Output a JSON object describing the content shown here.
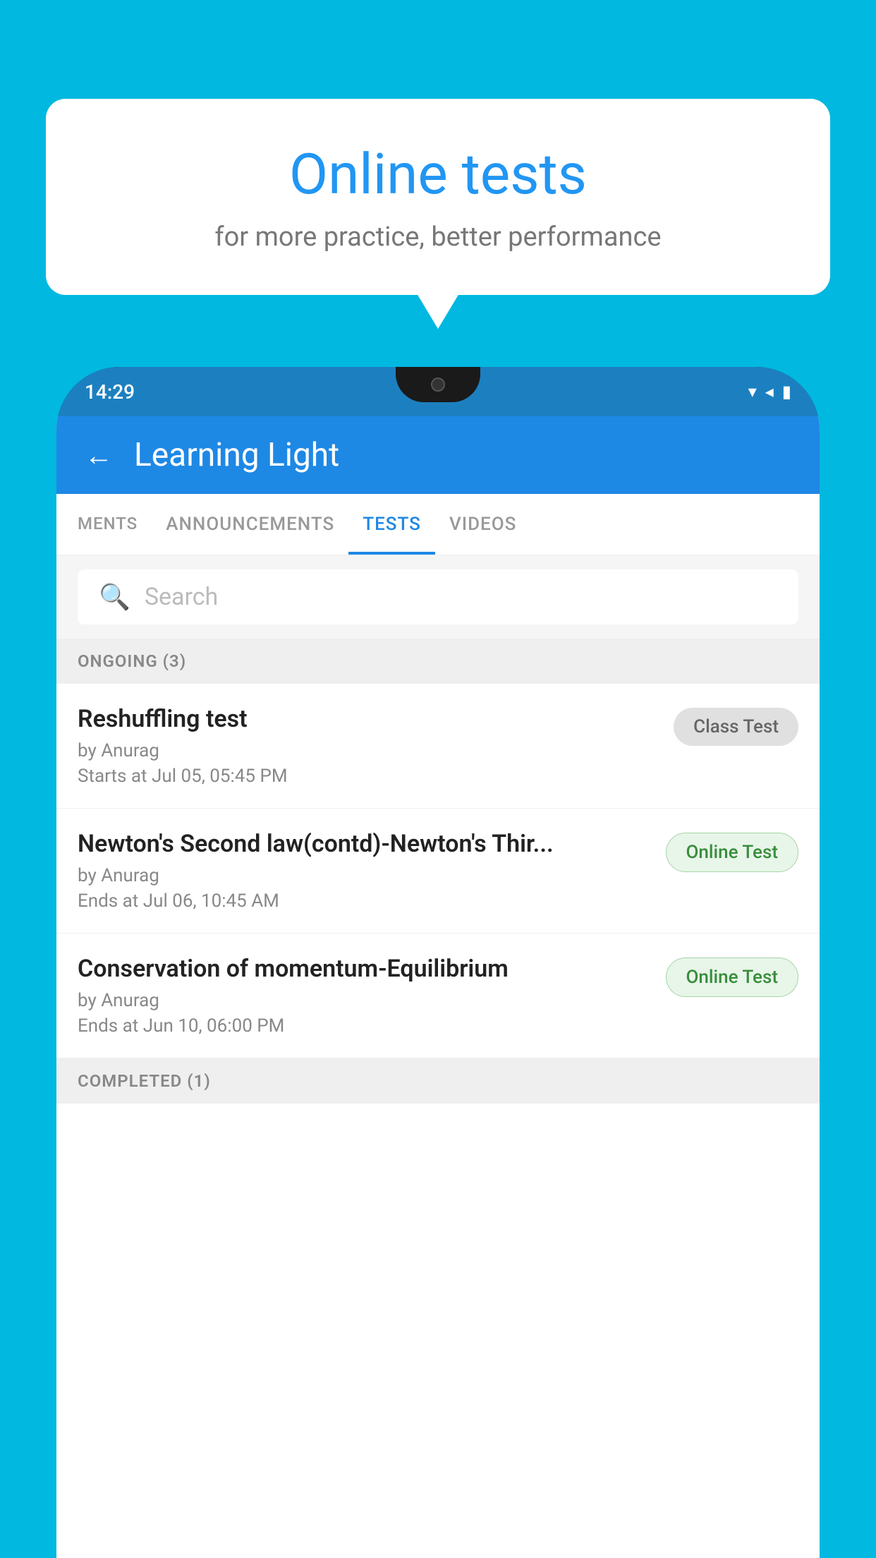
{
  "background_color": "#00b8e0",
  "bubble": {
    "title": "Online tests",
    "subtitle": "for more practice, better performance"
  },
  "status_bar": {
    "time": "14:29",
    "icons": [
      "wifi",
      "signal",
      "battery"
    ]
  },
  "header": {
    "title": "Learning Light",
    "back_label": "←"
  },
  "tabs": [
    {
      "id": "ments",
      "label": "MENTS",
      "active": false
    },
    {
      "id": "announcements",
      "label": "ANNOUNCEMENTS",
      "active": false
    },
    {
      "id": "tests",
      "label": "TESTS",
      "active": true
    },
    {
      "id": "videos",
      "label": "VIDEOS",
      "active": false
    }
  ],
  "search": {
    "placeholder": "Search"
  },
  "ongoing_section": {
    "label": "ONGOING (3)"
  },
  "tests": [
    {
      "name": "Reshuffling test",
      "author": "by Anurag",
      "time_label": "Starts at",
      "time": "Jul 05, 05:45 PM",
      "badge": "Class Test",
      "badge_type": "class"
    },
    {
      "name": "Newton's Second law(contd)-Newton's Thir...",
      "author": "by Anurag",
      "time_label": "Ends at",
      "time": "Jul 06, 10:45 AM",
      "badge": "Online Test",
      "badge_type": "online"
    },
    {
      "name": "Conservation of momentum-Equilibrium",
      "author": "by Anurag",
      "time_label": "Ends at",
      "time": "Jun 10, 06:00 PM",
      "badge": "Online Test",
      "badge_type": "online"
    }
  ],
  "completed_section": {
    "label": "COMPLETED (1)"
  }
}
